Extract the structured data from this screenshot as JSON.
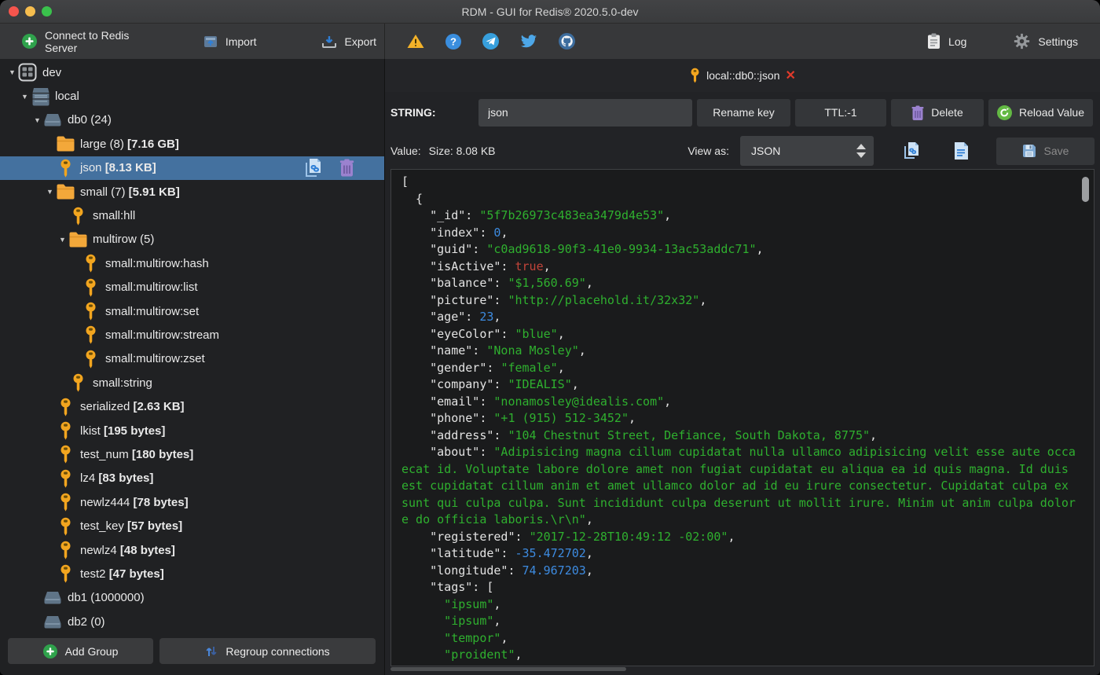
{
  "window": {
    "title": "RDM - GUI for Redis® 2020.5.0-dev"
  },
  "toolbar": {
    "connect_label": "Connect to Redis Server",
    "import_label": "Import",
    "export_label": "Export",
    "log_label": "Log",
    "settings_label": "Settings",
    "status_icons": [
      "warning-icon",
      "help-icon",
      "telegram-icon",
      "twitter-icon",
      "github-icon"
    ]
  },
  "sidebar": {
    "tree": [
      {
        "name": "connection-dev",
        "indent": 0,
        "arrow": true,
        "icon": "grid-icon",
        "label": "dev"
      },
      {
        "name": "server-local",
        "indent": 1,
        "arrow": true,
        "icon": "server-icon",
        "label": "local"
      },
      {
        "name": "db0",
        "indent": 2,
        "arrow": true,
        "icon": "db-icon",
        "label": "db0  (24)"
      },
      {
        "name": "ns-large",
        "indent": 3,
        "arrow": false,
        "icon": "folder-icon",
        "label": "large (8) ",
        "size": "[7.16 GB]"
      },
      {
        "name": "key-json",
        "indent": 3,
        "arrow": false,
        "icon": "key-icon",
        "label": "json ",
        "size": "[8.13 KB]",
        "selected": true,
        "actions": [
          "copy-link-icon",
          "trash-icon"
        ]
      },
      {
        "name": "ns-small",
        "indent": 3,
        "arrow": true,
        "icon": "folder-icon",
        "label": "small (7) ",
        "size": "[5.91 KB]"
      },
      {
        "name": "key-small-hll",
        "indent": 4,
        "arrow": false,
        "icon": "key-icon",
        "label": "small:hll"
      },
      {
        "name": "ns-multirow",
        "indent": 4,
        "arrow": true,
        "icon": "folder-icon",
        "label": "multirow (5)"
      },
      {
        "name": "key-multirow-hash",
        "indent": 5,
        "arrow": false,
        "icon": "key-icon",
        "label": "small:multirow:hash"
      },
      {
        "name": "key-multirow-list",
        "indent": 5,
        "arrow": false,
        "icon": "key-icon",
        "label": "small:multirow:list"
      },
      {
        "name": "key-multirow-set",
        "indent": 5,
        "arrow": false,
        "icon": "key-icon",
        "label": "small:multirow:set"
      },
      {
        "name": "key-multirow-stream",
        "indent": 5,
        "arrow": false,
        "icon": "key-icon",
        "label": "small:multirow:stream"
      },
      {
        "name": "key-multirow-zset",
        "indent": 5,
        "arrow": false,
        "icon": "key-icon",
        "label": "small:multirow:zset"
      },
      {
        "name": "key-small-string",
        "indent": 4,
        "arrow": false,
        "icon": "key-icon",
        "label": "small:string"
      },
      {
        "name": "key-serialized",
        "indent": 3,
        "arrow": false,
        "icon": "key-icon",
        "label": "serialized ",
        "size": "[2.63 KB]"
      },
      {
        "name": "key-lkist",
        "indent": 3,
        "arrow": false,
        "icon": "key-icon",
        "label": "lkist ",
        "size": "[195 bytes]"
      },
      {
        "name": "key-test-num",
        "indent": 3,
        "arrow": false,
        "icon": "key-icon",
        "label": "test_num ",
        "size": "[180 bytes]"
      },
      {
        "name": "key-lz4",
        "indent": 3,
        "arrow": false,
        "icon": "key-icon",
        "label": "lz4 ",
        "size": "[83 bytes]"
      },
      {
        "name": "key-newlz444",
        "indent": 3,
        "arrow": false,
        "icon": "key-icon",
        "label": "newlz444 ",
        "size": "[78 bytes]"
      },
      {
        "name": "key-test-key",
        "indent": 3,
        "arrow": false,
        "icon": "key-icon",
        "label": "test_key ",
        "size": "[57 bytes]"
      },
      {
        "name": "key-newlz4",
        "indent": 3,
        "arrow": false,
        "icon": "key-icon",
        "label": "newlz4 ",
        "size": "[48 bytes]"
      },
      {
        "name": "key-test2",
        "indent": 3,
        "arrow": false,
        "icon": "key-icon",
        "label": "test2 ",
        "size": "[47 bytes]"
      },
      {
        "name": "db1",
        "indent": 2,
        "arrow": false,
        "icon": "db-icon",
        "label": "db1  (1000000)"
      },
      {
        "name": "db2",
        "indent": 2,
        "arrow": false,
        "icon": "db-icon",
        "label": "db2  (0)"
      }
    ],
    "add_group_label": "Add Group",
    "regroup_label": "Regroup connections"
  },
  "main": {
    "tab": {
      "title": "local::db0::json",
      "icons": [
        "key-icon",
        "close-icon"
      ]
    },
    "key_row": {
      "type_label": "STRING:",
      "key_value": "json",
      "rename_label": "Rename key",
      "ttl_label": "TTL:-1",
      "delete_label": "Delete",
      "reload_label": "Reload Value"
    },
    "value_row": {
      "value_label": "Value:",
      "size_label": "Size: 8.08 KB",
      "view_as_label": "View as:",
      "view_mode": "JSON",
      "save_label": "Save",
      "icons": [
        "open-in-new-editor-icon",
        "view-raw-icon",
        "save-icon"
      ]
    }
  },
  "editor": {
    "lines": [
      [
        [
          "w",
          "["
        ]
      ],
      [
        [
          "w",
          "  {"
        ]
      ],
      [
        [
          "w",
          "    \"_id\": "
        ],
        [
          "s",
          "\"5f7b26973c483ea3479d4e53\""
        ],
        [
          "w",
          ","
        ]
      ],
      [
        [
          "w",
          "    \"index\": "
        ],
        [
          "n",
          "0"
        ],
        [
          "w",
          ","
        ]
      ],
      [
        [
          "w",
          "    \"guid\": "
        ],
        [
          "s",
          "\"c0ad9618-90f3-41e0-9934-13ac53addc71\""
        ],
        [
          "w",
          ","
        ]
      ],
      [
        [
          "w",
          "    \"isActive\": "
        ],
        [
          "b",
          "true"
        ],
        [
          "w",
          ","
        ]
      ],
      [
        [
          "w",
          "    \"balance\": "
        ],
        [
          "s",
          "\"$1,560.69\""
        ],
        [
          "w",
          ","
        ]
      ],
      [
        [
          "w",
          "    \"picture\": "
        ],
        [
          "s",
          "\"http://placehold.it/32x32\""
        ],
        [
          "w",
          ","
        ]
      ],
      [
        [
          "w",
          "    \"age\": "
        ],
        [
          "n",
          "23"
        ],
        [
          "w",
          ","
        ]
      ],
      [
        [
          "w",
          "    \"eyeColor\": "
        ],
        [
          "s",
          "\"blue\""
        ],
        [
          "w",
          ","
        ]
      ],
      [
        [
          "w",
          "    \"name\": "
        ],
        [
          "s",
          "\"Nona Mosley\""
        ],
        [
          "w",
          ","
        ]
      ],
      [
        [
          "w",
          "    \"gender\": "
        ],
        [
          "s",
          "\"female\""
        ],
        [
          "w",
          ","
        ]
      ],
      [
        [
          "w",
          "    \"company\": "
        ],
        [
          "s",
          "\"IDEALIS\""
        ],
        [
          "w",
          ","
        ]
      ],
      [
        [
          "w",
          "    \"email\": "
        ],
        [
          "s",
          "\"nonamosley@idealis.com\""
        ],
        [
          "w",
          ","
        ]
      ],
      [
        [
          "w",
          "    \"phone\": "
        ],
        [
          "s",
          "\"+1 (915) 512-3452\""
        ],
        [
          "w",
          ","
        ]
      ],
      [
        [
          "w",
          "    \"address\": "
        ],
        [
          "s",
          "\"104 Chestnut Street, Defiance, South Dakota, 8775\""
        ],
        [
          "w",
          ","
        ]
      ],
      [
        [
          "w",
          "    \"about\": "
        ],
        [
          "s",
          "\"Adipisicing magna cillum cupidatat nulla ullamco adipisicing velit esse aute occa"
        ]
      ],
      [
        [
          "s",
          "ecat id. Voluptate labore dolore amet non fugiat cupidatat eu aliqua ea id quis magna. Id duis"
        ]
      ],
      [
        [
          "s",
          "est cupidatat cillum anim et amet ullamco dolor ad id eu irure consectetur. Cupidatat culpa ex"
        ]
      ],
      [
        [
          "s",
          "sunt qui culpa culpa. Sunt incididunt culpa deserunt ut mollit irure. Minim ut anim culpa dolor"
        ]
      ],
      [
        [
          "s",
          "e do officia laboris.\\r\\n\""
        ],
        [
          "w",
          ","
        ]
      ],
      [
        [
          "w",
          "    \"registered\": "
        ],
        [
          "s",
          "\"2017-12-28T10:49:12 -02:00\""
        ],
        [
          "w",
          ","
        ]
      ],
      [
        [
          "w",
          "    \"latitude\": "
        ],
        [
          "n",
          "-35.472702"
        ],
        [
          "w",
          ","
        ]
      ],
      [
        [
          "w",
          "    \"longitude\": "
        ],
        [
          "n",
          "74.967203"
        ],
        [
          "w",
          ","
        ]
      ],
      [
        [
          "w",
          "    \"tags\": ["
        ]
      ],
      [
        [
          "s",
          "      \"ipsum\""
        ],
        [
          "w",
          ","
        ]
      ],
      [
        [
          "s",
          "      \"ipsum\""
        ],
        [
          "w",
          ","
        ]
      ],
      [
        [
          "s",
          "      \"tempor\""
        ],
        [
          "w",
          ","
        ]
      ],
      [
        [
          "s",
          "      \"proident\""
        ],
        [
          "w",
          ","
        ]
      ]
    ]
  },
  "colors": {
    "selection": "#44719f",
    "string_value": "#2fb02f",
    "number_value": "#3d8be0",
    "boolean_value": "#c2443a",
    "key_folder": "#f2a51f",
    "accent_green": "#3fae4c",
    "accent_purple": "#9b82cf",
    "accent_blue": "#3d8be0"
  }
}
